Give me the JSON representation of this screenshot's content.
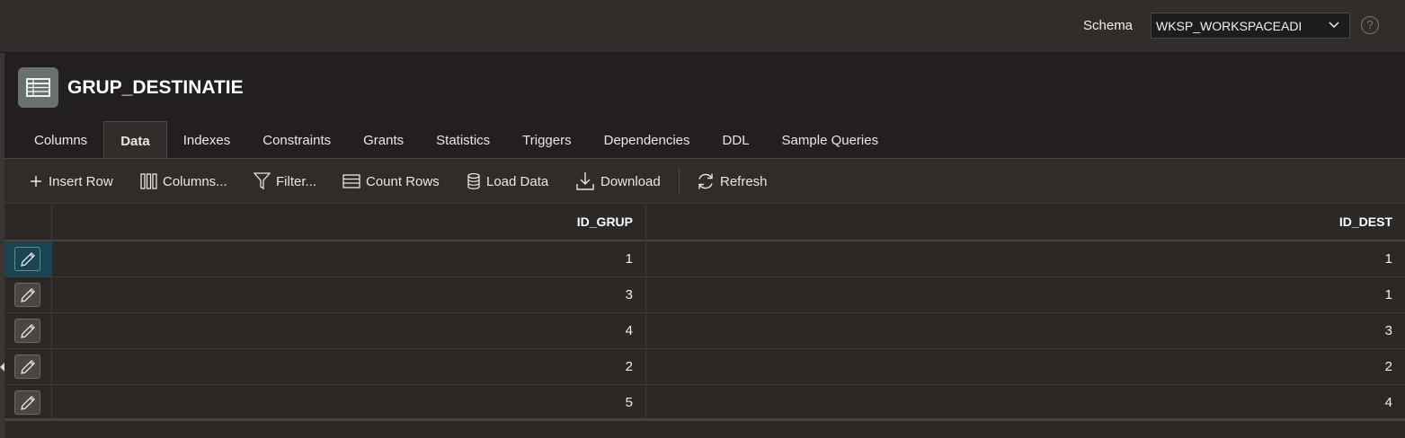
{
  "header": {
    "schema_label": "Schema",
    "schema_value": "WKSP_WORKSPACEADI",
    "help": "?"
  },
  "object": {
    "name": "GRUP_DESTINATIE",
    "icon": "table-icon"
  },
  "tabs": [
    {
      "label": "Columns",
      "active": false
    },
    {
      "label": "Data",
      "active": true
    },
    {
      "label": "Indexes",
      "active": false
    },
    {
      "label": "Constraints",
      "active": false
    },
    {
      "label": "Grants",
      "active": false
    },
    {
      "label": "Statistics",
      "active": false
    },
    {
      "label": "Triggers",
      "active": false
    },
    {
      "label": "Dependencies",
      "active": false
    },
    {
      "label": "DDL",
      "active": false
    },
    {
      "label": "Sample Queries",
      "active": false
    }
  ],
  "toolbar": {
    "insert_row": "Insert Row",
    "columns": "Columns...",
    "filter": "Filter...",
    "count_rows": "Count Rows",
    "load_data": "Load Data",
    "download": "Download",
    "refresh": "Refresh"
  },
  "grid": {
    "columns": [
      "ID_GRUP",
      "ID_DEST"
    ],
    "rows": [
      [
        "1",
        "1"
      ],
      [
        "3",
        "1"
      ],
      [
        "4",
        "3"
      ],
      [
        "2",
        "2"
      ],
      [
        "5",
        "4"
      ]
    ]
  },
  "colors": {
    "background": "#2b2826",
    "selected_row": "#1b4451",
    "icon_tile": "#687172"
  }
}
